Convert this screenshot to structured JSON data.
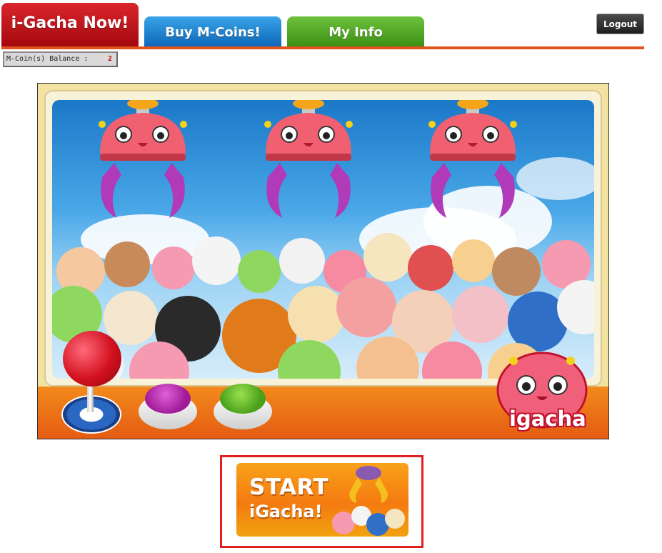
{
  "tabs": [
    {
      "label": "i-Gacha Now!",
      "active": true
    },
    {
      "label": "Buy M-Coins!",
      "active": false
    },
    {
      "label": "My Info",
      "active": false
    }
  ],
  "header": {
    "logout_label": "Logout"
  },
  "balance": {
    "label": "M-Coin(s) Balance :",
    "value": "2"
  },
  "machine": {
    "logo_text": "igacha"
  },
  "start_button": {
    "line1": "START",
    "line2": "iGacha!"
  },
  "colors": {
    "tab_red": "#c8141c",
    "tab_blue": "#1b7fd0",
    "tab_green": "#4fa824",
    "rule_orange": "#e0531c",
    "start_outline": "#e02020"
  }
}
